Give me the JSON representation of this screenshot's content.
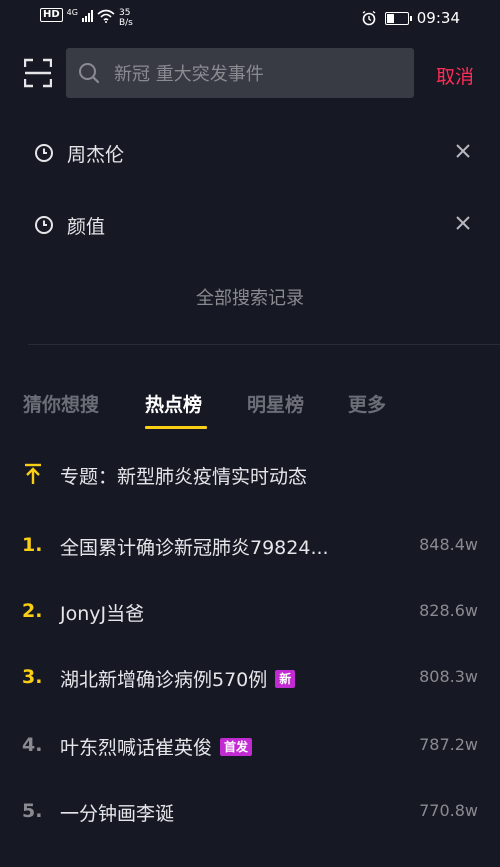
{
  "status_bar": {
    "hd": "HD",
    "network": "4G",
    "speed_value": "35",
    "speed_unit": "B/s",
    "time": "09:34",
    "battery_level": 0.35
  },
  "search": {
    "placeholder": "新冠 重大突发事件",
    "cancel_label": "取消"
  },
  "history": {
    "items": [
      {
        "label": "周杰伦"
      },
      {
        "label": "颜值"
      }
    ],
    "all_label": "全部搜索记录"
  },
  "tabs": [
    {
      "label": "猜你想搜",
      "active": false
    },
    {
      "label": "热点榜",
      "active": true
    },
    {
      "label": "明星榜",
      "active": false
    },
    {
      "label": "更多",
      "active": false
    }
  ],
  "topic": {
    "label": "专题：新型肺炎疫情实时动态"
  },
  "hot_list": [
    {
      "rank": "1.",
      "title": "全国累计确诊新冠肺炎79824...",
      "heat": "848.4w",
      "badge": "",
      "rank_color": "#face15"
    },
    {
      "rank": "2.",
      "title": "JonyJ当爸",
      "heat": "828.6w",
      "badge": "",
      "rank_color": "#face15"
    },
    {
      "rank": "3.",
      "title": "湖北新增确诊病例570例",
      "heat": "808.3w",
      "badge": "新",
      "rank_color": "#face15"
    },
    {
      "rank": "4.",
      "title": "叶东烈喊话崔英俊",
      "heat": "787.2w",
      "badge": "首发",
      "rank_color": "#8a8b91"
    },
    {
      "rank": "5.",
      "title": "一分钟画李诞",
      "heat": "770.8w",
      "badge": "",
      "rank_color": "#8a8b91"
    }
  ],
  "colors": {
    "background": "#161823",
    "accent_yellow": "#face15",
    "cancel_red": "#fe2c55",
    "badge_purple": "#c12bd1"
  }
}
